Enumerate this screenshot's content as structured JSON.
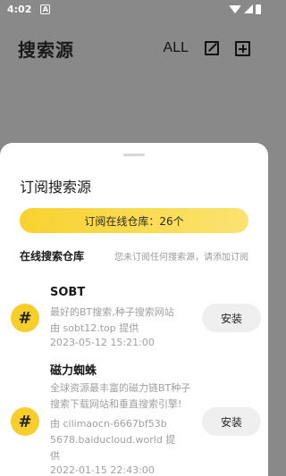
{
  "status": {
    "time": "4:02",
    "a_label": "A"
  },
  "appbar": {
    "title": "搜索源",
    "all_label": "ALL"
  },
  "sheet": {
    "title": "订阅搜索源",
    "pill_label": "订阅在线仓库：26个",
    "section_title": "在线搜索仓库",
    "section_hint": "您未订阅任何搜索源，请添加订阅"
  },
  "items": [
    {
      "badge": "#",
      "name": "SOBT",
      "lines": [
        "最好的BT搜索,种子搜索网站",
        "由 sobt12.top 提供",
        "2023-05-12 15:21:00"
      ],
      "install_label": "安装"
    },
    {
      "badge": "#",
      "name": "磁力蜘蛛",
      "lines": [
        "全球资源最丰富的磁力链BT种子",
        "搜索下载网站和垂直搜索引擎!",
        "由 cilimaocn-6667bf53b",
        "5678.baiducloud.world 提",
        "供",
        "2022-01-15 22:43:00"
      ],
      "install_label": "安装"
    }
  ],
  "colors": {
    "accent": "#f8ce2a",
    "scrim": "#898989"
  }
}
